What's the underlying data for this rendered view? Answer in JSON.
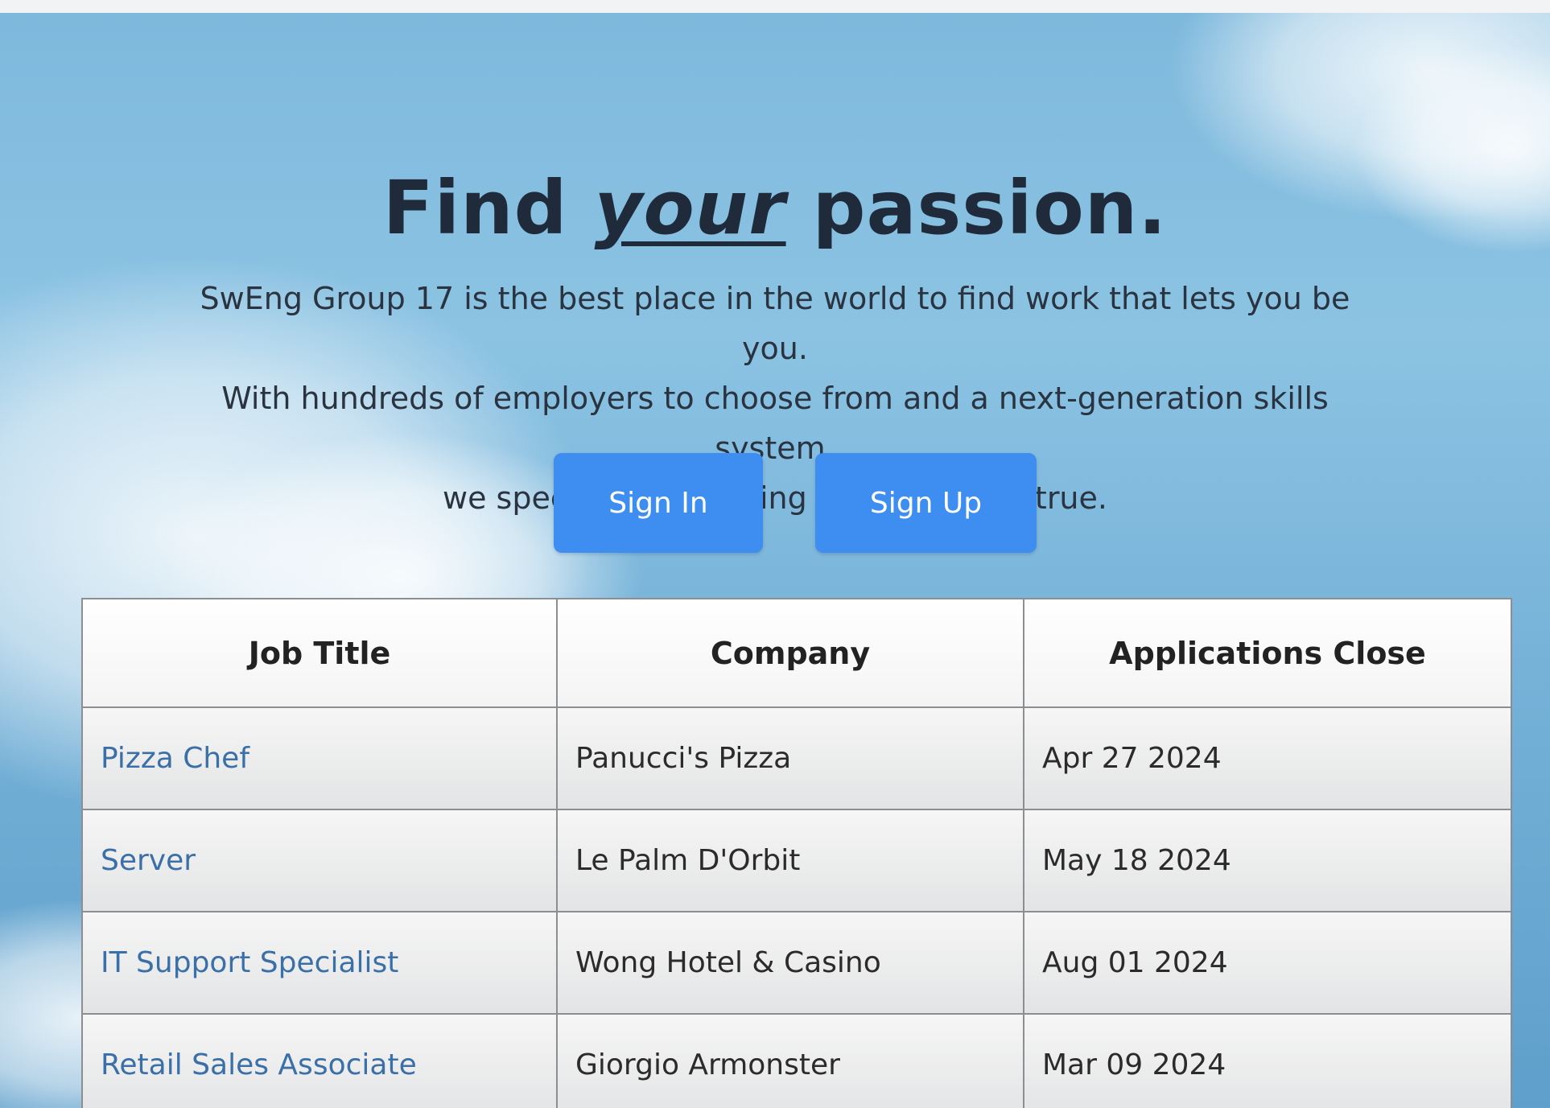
{
  "hero": {
    "headline_prefix": "Find",
    "headline_emphasis": "your",
    "headline_suffix": "passion.",
    "lead_line1": "SwEng Group 17 is the best place in the world to find work that lets you be you.",
    "lead_line2": "With hundreds of employers to choose from and a next-generation skills system,",
    "lead_line3": "we specialise in making dreams come true."
  },
  "actions": {
    "sign_in": "Sign In",
    "sign_up": "Sign Up"
  },
  "jobs": {
    "columns": [
      "Job Title",
      "Company",
      "Applications Close"
    ],
    "rows": [
      {
        "title": "Pizza Chef",
        "company": "Panucci's Pizza",
        "close": "Apr 27 2024"
      },
      {
        "title": "Server",
        "company": "Le Palm D'Orbit",
        "close": "May 18 2024"
      },
      {
        "title": "IT Support Specialist",
        "company": "Wong Hotel & Casino",
        "close": "Aug 01 2024"
      },
      {
        "title": "Retail Sales Associate",
        "company": "Giorgio Armonster",
        "close": "Mar 09 2024"
      }
    ]
  },
  "colors": {
    "button": "#3d8ef0",
    "link": "#3a6fa8",
    "headline": "#1f2b3a"
  }
}
